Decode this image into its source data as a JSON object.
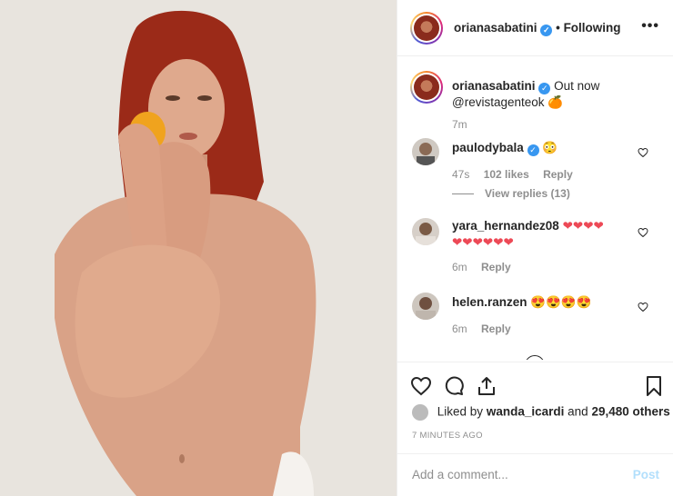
{
  "post": {
    "username": "orianasabatini",
    "follow_status": "Following",
    "dot": "•",
    "more_label": "•••",
    "caption": {
      "username": "orianasabatini",
      "text": "Out now",
      "mention": "@revistagenteok",
      "emoji": "🍊",
      "time": "7m"
    }
  },
  "comments": [
    {
      "username": "paulodybala",
      "text": "😳",
      "time": "47s",
      "likes": "102 likes",
      "reply": "Reply",
      "view_replies": "View replies (13)",
      "verified": true
    },
    {
      "username": "yara_hernandez08",
      "text": "❤❤❤❤",
      "text2": "❤❤❤❤❤❤",
      "time": "6m",
      "reply": "Reply"
    },
    {
      "username": "helen.ranzen",
      "text": "😍😍😍😍",
      "time": "6m",
      "reply": "Reply"
    }
  ],
  "footer": {
    "liked_by_prefix": "Liked by",
    "liked_by_user": "wanda_icardi",
    "liked_by_and": "and",
    "liked_by_count": "29,480 others",
    "timestamp": "7 MINUTES AGO",
    "comment_placeholder": "Add a comment...",
    "post_label": "Post"
  },
  "colors": {
    "accent": "#3897f0",
    "post_disabled": "#b2dffc",
    "heart_red": "#ed4956"
  },
  "icons": [
    "heart-icon",
    "comment-icon",
    "share-icon",
    "bookmark-icon",
    "more-icon",
    "verified-icon"
  ]
}
